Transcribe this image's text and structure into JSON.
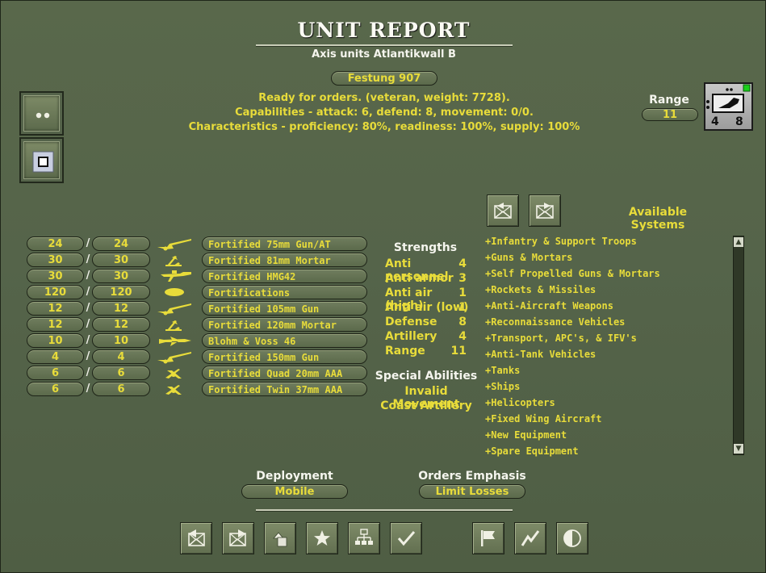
{
  "header": {
    "title": "UNIT REPORT",
    "subtitle": "Axis units Atlantikwall B",
    "unit_name": "Festung 907"
  },
  "status": {
    "line1": "Ready for orders. (veteran, weight: 7728).",
    "line2": "Capabilities - attack: 6, defend: 8, movement: 0/0.",
    "line3": "Characteristics - proficiency: 80%, readiness: 100%, supply: 100%"
  },
  "range": {
    "label": "Range",
    "value": "11"
  },
  "counter": {
    "attack": "4",
    "defend": "8"
  },
  "equipment": [
    {
      "current": "24",
      "max": "24",
      "name": "Fortified 75mm Gun/AT",
      "icon": "gun-icon"
    },
    {
      "current": "30",
      "max": "30",
      "name": "Fortified 81mm Mortar",
      "icon": "mortar-icon"
    },
    {
      "current": "30",
      "max": "30",
      "name": "Fortified HMG42",
      "icon": "machine-gun-icon"
    },
    {
      "current": "120",
      "max": "120",
      "name": "Fortifications",
      "icon": "fortification-icon"
    },
    {
      "current": "12",
      "max": "12",
      "name": "Fortified 105mm Gun",
      "icon": "gun-icon"
    },
    {
      "current": "12",
      "max": "12",
      "name": "Fortified 120mm Mortar",
      "icon": "mortar-icon"
    },
    {
      "current": "10",
      "max": "10",
      "name": "Blohm & Voss 46",
      "icon": "aircraft-icon"
    },
    {
      "current": "4",
      "max": "4",
      "name": "Fortified 150mm Gun",
      "icon": "gun-icon"
    },
    {
      "current": "6",
      "max": "6",
      "name": "Fortified Quad 20mm AAA",
      "icon": "aa-gun-icon"
    },
    {
      "current": "6",
      "max": "6",
      "name": "Fortified Twin 37mm AAA",
      "icon": "aa-gun-icon"
    }
  ],
  "strengths": {
    "heading": "Strengths",
    "rows": [
      {
        "label": "Anti personnel",
        "value": "4"
      },
      {
        "label": "Anti armor",
        "value": "3"
      },
      {
        "label": "Anti air (high)",
        "value": "1"
      },
      {
        "label": "Anti air (low)",
        "value": "1"
      },
      {
        "label": "Defense",
        "value": "8"
      },
      {
        "label": "Artillery",
        "value": "4"
      },
      {
        "label": "Range",
        "value": "11"
      }
    ]
  },
  "special_abilities": {
    "heading": "Special Abilities",
    "items": [
      "Invalid Movement",
      "Coast Artillery"
    ]
  },
  "available_systems": {
    "heading": "Available Systems",
    "items": [
      "+Infantry & Support Troops",
      "+Guns & Mortars",
      "+Self Propelled Guns & Mortars",
      "+Rockets & Missiles",
      "+Anti-Aircraft Weapons",
      "+Reconnaissance Vehicles",
      "+Transport, APC's, & IFV's",
      "+Anti-Tank Vehicles",
      "+Tanks",
      "+Ships",
      "+Helicopters",
      "+Fixed Wing Aircraft",
      "+New Equipment",
      "+Spare Equipment"
    ]
  },
  "deployment": {
    "label": "Deployment",
    "value": "Mobile"
  },
  "orders": {
    "label": "Orders Emphasis",
    "value": "Limit Losses"
  },
  "colors": {
    "panel": "#55644a",
    "accent_yellow": "#e8dc3a",
    "text_white": "#f5f5ee"
  },
  "bottom_toolbar": [
    "mail-in-icon",
    "mail-out-icon",
    "shapes-icon",
    "star-icon",
    "org-chart-icon",
    "checkmark-icon",
    "flag-icon",
    "trend-icon",
    "contrast-icon"
  ]
}
